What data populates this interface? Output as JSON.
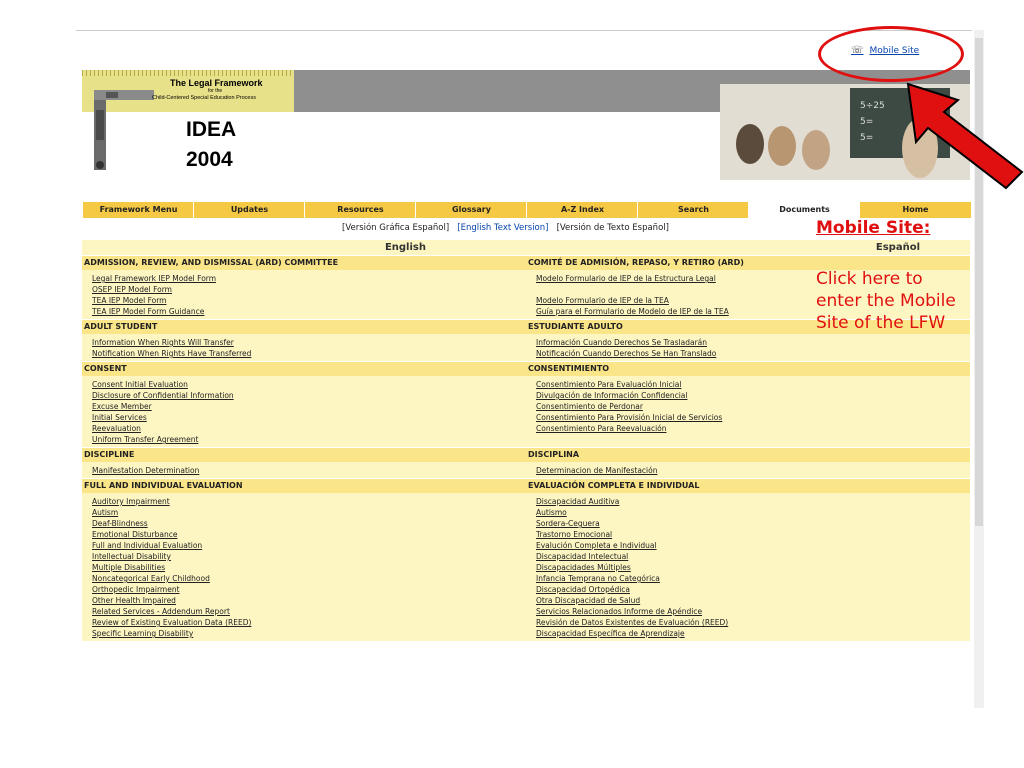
{
  "header": {
    "mobile_link": "Mobile Site",
    "logo_title": "The Legal Framework",
    "logo_for": "for the",
    "logo_subtitle": "Child-Centered Special Education Process",
    "logo_idea": "IDEA",
    "logo_year": "2004"
  },
  "nav": [
    {
      "label": "Framework Menu"
    },
    {
      "label": "Updates"
    },
    {
      "label": "Resources"
    },
    {
      "label": "Glossary"
    },
    {
      "label": "A-Z Index"
    },
    {
      "label": "Search"
    },
    {
      "label": "Documents"
    },
    {
      "label": "Home"
    }
  ],
  "lang_links": {
    "graphic_es": "[Versión Gráfica Español]",
    "text_en": "[English Text Version]",
    "text_es": "[Versión de Texto Español]"
  },
  "columns": {
    "english": "English",
    "spanish": "Español"
  },
  "sections": [
    {
      "en_title": "ADMISSION, REVIEW, AND DISMISSAL (ARD) COMMITTEE",
      "es_title": "COMITÉ DE ADMISIÓN, REPASO, Y RETIRO (ARD)",
      "en_items": [
        "Legal Framework IEP Model Form",
        "OSEP IEP Model Form",
        "TEA IEP Model Form",
        "TEA IEP Model Form Guidance"
      ],
      "es_items": [
        "Modelo Formulario de IEP de la Estructura Legal",
        "",
        "Modelo Formulario de IEP de la TEA",
        "Guía para el Formulario de Modelo de IEP de la TEA"
      ]
    },
    {
      "en_title": "ADULT STUDENT",
      "es_title": "ESTUDIANTE ADULTO",
      "en_items": [
        "Information When Rights Will Transfer",
        "Notification When Rights Have Transferred"
      ],
      "es_items": [
        "Información Cuando Derechos Se Trasladarán",
        "Notificación Cuando Derechos Se Han Translado"
      ]
    },
    {
      "en_title": "CONSENT",
      "es_title": "CONSENTIMIENTO",
      "en_items": [
        "Consent Initial Evaluation",
        "Disclosure of Confidential Information",
        "Excuse Member",
        "Initial Services",
        "Reevaluation",
        "Uniform Transfer Agreement"
      ],
      "es_items": [
        "Consentimiento Para Evaluación Inicial",
        "Divulgación de Información Confidencial",
        "Consentimiento de Perdonar",
        "Consentimiento Para Provisión Inicial de Servicios",
        "Consentimiento Para Reevaluación",
        ""
      ]
    },
    {
      "en_title": "DISCIPLINE",
      "es_title": "DISCIPLINA",
      "en_items": [
        "Manifestation Determination"
      ],
      "es_items": [
        "Determinacion de Manifestación"
      ]
    },
    {
      "en_title": "FULL AND INDIVIDUAL EVALUATION",
      "es_title": "EVALUACIÓN COMPLETA E INDIVIDUAL",
      "en_items": [
        "Auditory Impairment",
        "Autism",
        "Deaf-Blindness",
        "Emotional Disturbance",
        "Full and Individual Evaluation",
        "Intellectual Disability",
        "Multiple Disabilities",
        "Noncategorical Early Childhood",
        "Orthopedic Impairment",
        "Other Health Impaired",
        "Related Services - Addendum Report",
        "Review of Existing Evaluation Data (REED)",
        "Specific Learning Disability"
      ],
      "es_items": [
        "Discapacidad Auditiva",
        "Autismo",
        "Sordera-Ceguera",
        "Trastorno Emocional",
        "Evalución Completa e Individual",
        "Discapacidad Intelectual",
        "Discapacidades Múltiples",
        "Infancia Temprana no Categórica",
        "Discapacidad Ortopédica",
        "Otra Discapacidad de Salud",
        "Servicios Relacionados Informe de Apéndice",
        "Revisión de Datos Existentes de Evaluación (REED)",
        "Discapacidad Específica de Aprendizaje"
      ]
    }
  ],
  "annotation": {
    "title": "Mobile Site:",
    "text": "Click here to\nenter the Mobile\nSite of the LFW",
    "color": "#e01010"
  },
  "colors": {
    "nav_bg": "#f6c944",
    "section_bg": "#fae589",
    "item_bg": "#fdf6c3",
    "link": "#0645ad"
  }
}
